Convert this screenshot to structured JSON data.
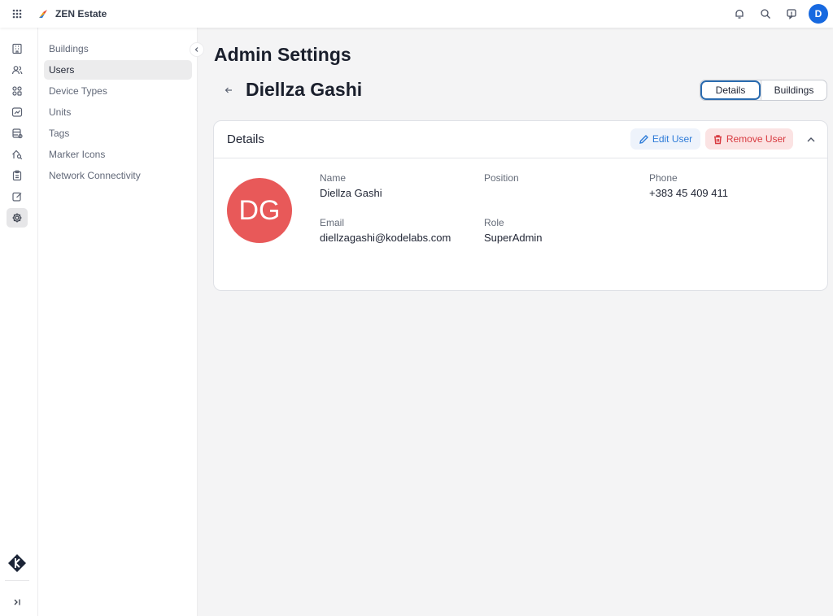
{
  "topbar": {
    "app_name": "ZEN Estate",
    "user_initial": "D",
    "icons": [
      "apps-grid-icon",
      "app-logo-icon",
      "notification-bell-icon",
      "search-icon",
      "feedback-icon"
    ]
  },
  "rail": {
    "items": [
      "building-icon",
      "users-icon",
      "grid-icon",
      "analytics-icon",
      "database-icon",
      "home-search-icon",
      "clipboard-icon",
      "edit-icon",
      "settings-icon"
    ],
    "active": "settings-icon"
  },
  "submenu": {
    "items": [
      {
        "label": "Buildings"
      },
      {
        "label": "Users"
      },
      {
        "label": "Device Types"
      },
      {
        "label": "Units"
      },
      {
        "label": "Tags"
      },
      {
        "label": "Marker Icons"
      },
      {
        "label": "Network Connectivity"
      }
    ],
    "active": "Users"
  },
  "main": {
    "page_title": "Admin Settings",
    "user_title": "Diellza Gashi",
    "tabs": [
      {
        "label": "Details",
        "selected": true
      },
      {
        "label": "Buildings",
        "selected": false
      }
    ]
  },
  "card": {
    "title": "Details",
    "edit_label": "Edit User",
    "remove_label": "Remove User",
    "avatar_initials": "DG",
    "avatar_color": "#e85959",
    "fields": {
      "name": {
        "label": "Name",
        "value": "Diellza Gashi"
      },
      "position": {
        "label": "Position",
        "value": ""
      },
      "phone": {
        "label": "Phone",
        "value": "+383 45 409 411"
      },
      "email": {
        "label": "Email",
        "value": "diellzagashi@kodelabs.com"
      },
      "role": {
        "label": "Role",
        "value": "SuperAdmin"
      }
    }
  },
  "colors": {
    "accent": "#1769e0",
    "edit": "#2d7bd8",
    "danger": "#d8393f"
  }
}
